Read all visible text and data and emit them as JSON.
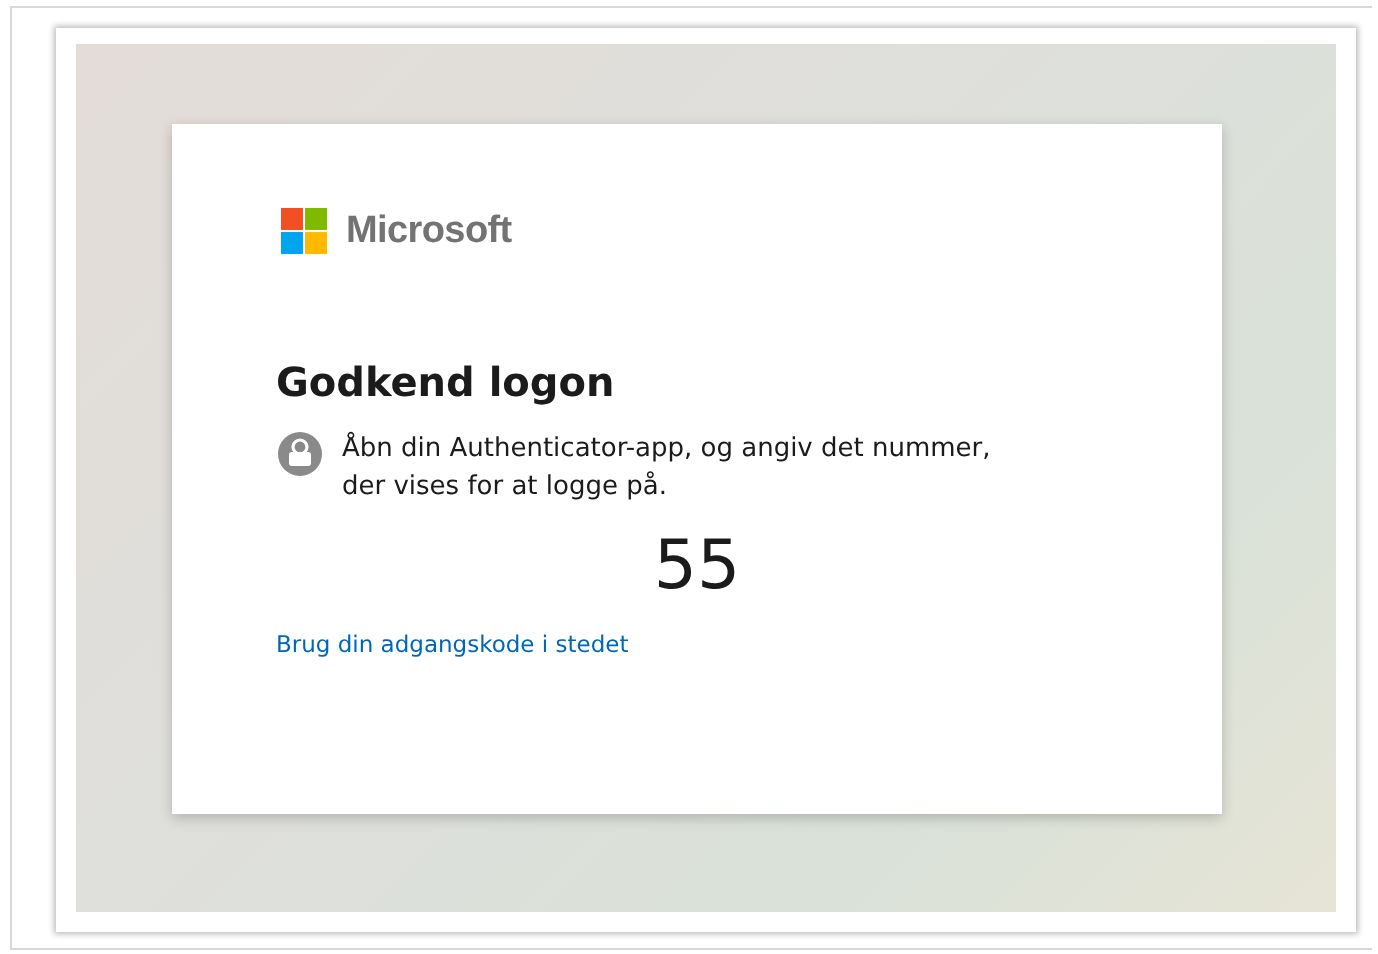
{
  "brand": {
    "name": "Microsoft"
  },
  "title": "Godkend logon",
  "instruction": "Åbn din Authenticator-app, og angiv det nummer, der vises for at logge på.",
  "number": "55",
  "link": "Brug din adgangskode i stedet"
}
